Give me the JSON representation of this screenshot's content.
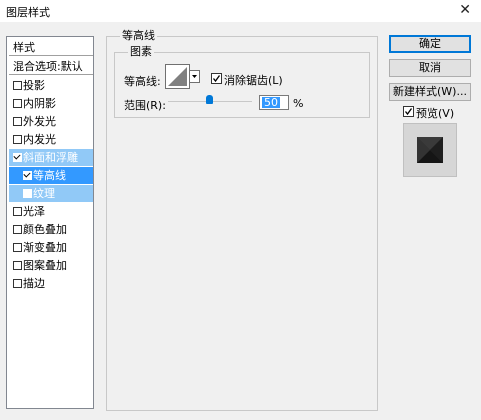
{
  "window": {
    "title": "图层样式",
    "close_glyph": "✕"
  },
  "sidebar": {
    "header": "样式",
    "blend_options": "混合选项:默认",
    "items": [
      {
        "label": "投影",
        "checked": false
      },
      {
        "label": "内阴影",
        "checked": false
      },
      {
        "label": "外发光",
        "checked": false
      },
      {
        "label": "内发光",
        "checked": false
      },
      {
        "label": "斜面和浮雕",
        "checked": true
      },
      {
        "label": "等高线",
        "checked": true
      },
      {
        "label": "纹理",
        "checked": false
      },
      {
        "label": "光泽",
        "checked": false
      },
      {
        "label": "颜色叠加",
        "checked": false
      },
      {
        "label": "渐变叠加",
        "checked": false
      },
      {
        "label": "图案叠加",
        "checked": false
      },
      {
        "label": "描边",
        "checked": false
      }
    ]
  },
  "panel": {
    "section_title": "等高线",
    "group_title": "图素",
    "contour_label": "等高线:",
    "antialias_label": "消除锯齿(L)",
    "antialias_checked": true,
    "range_label": "范围(R):",
    "range_value": "50",
    "range_unit": "%"
  },
  "buttons": {
    "ok": "确定",
    "cancel": "取消",
    "new_style": "新建样式(W)...",
    "preview_label": "预览(V)",
    "preview_checked": true
  }
}
